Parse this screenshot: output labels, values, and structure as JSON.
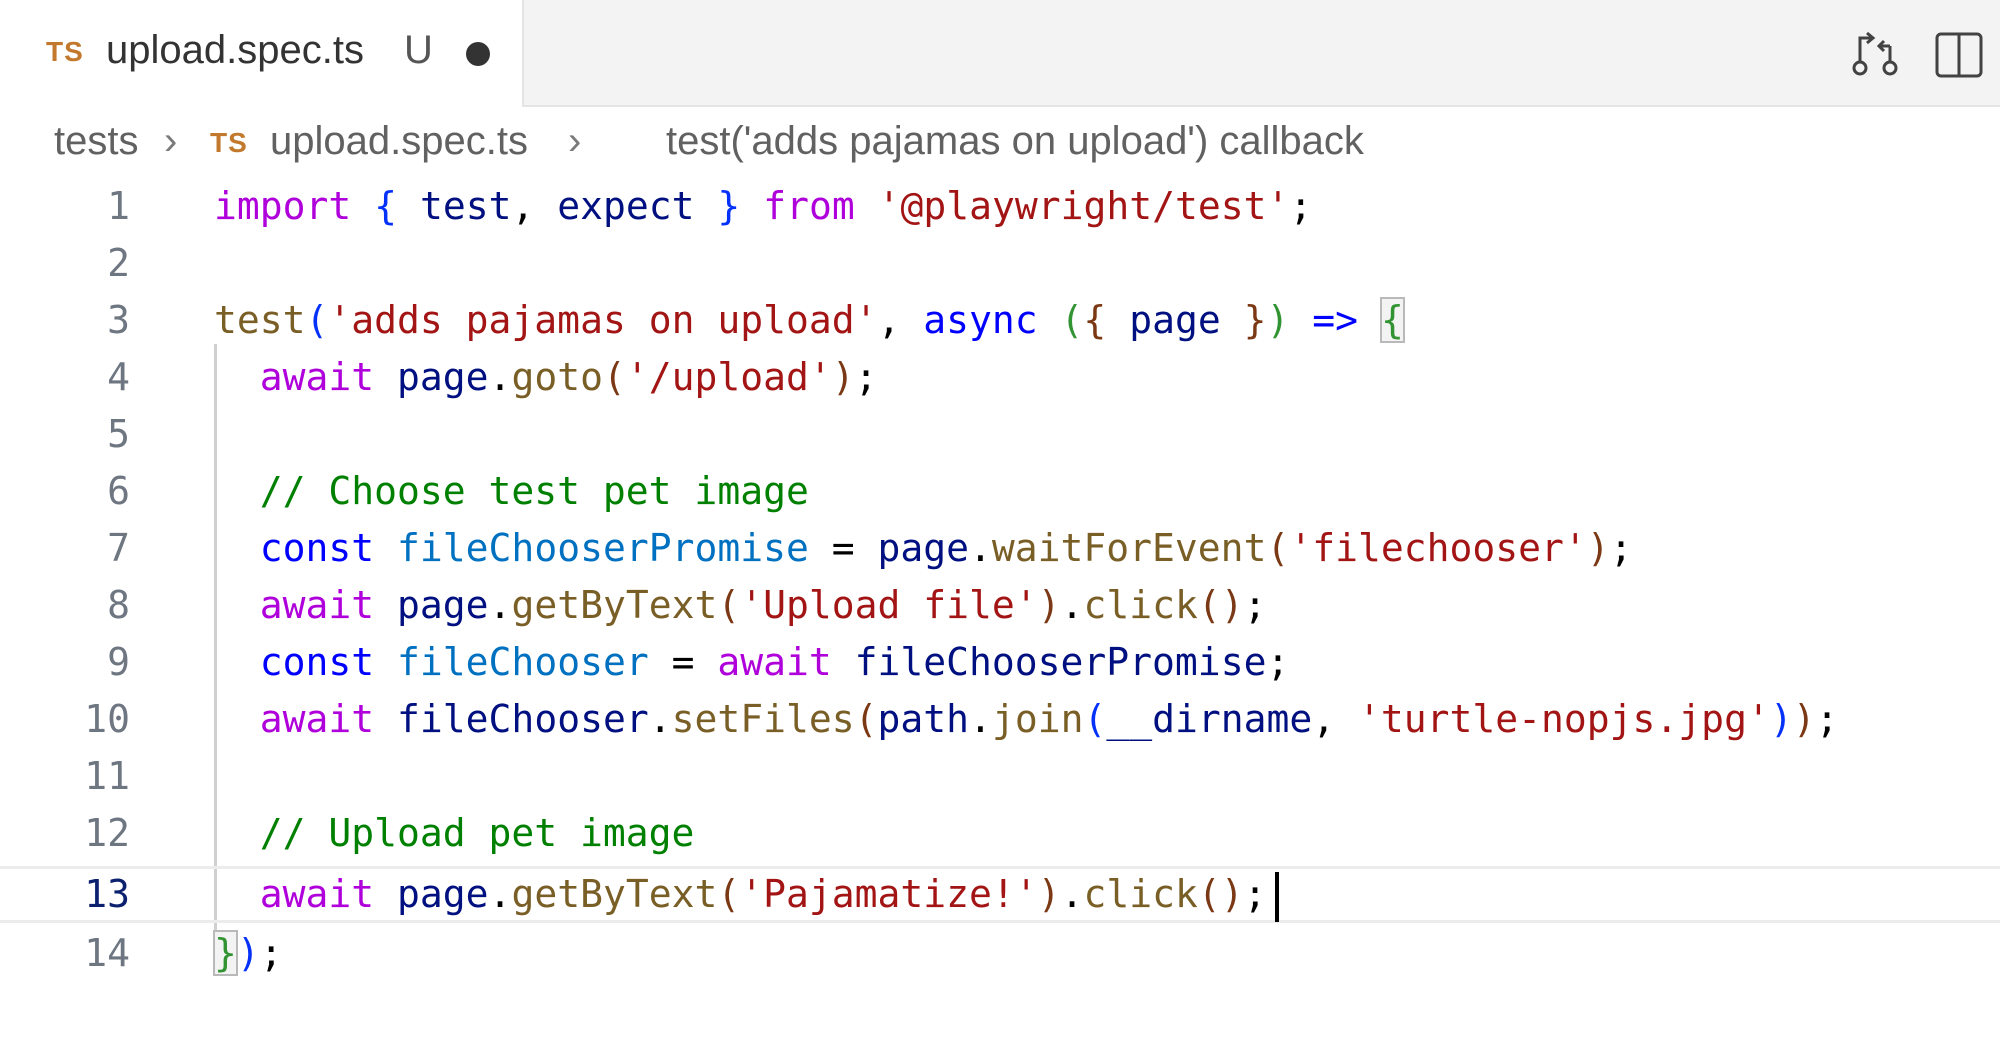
{
  "tab": {
    "file_type": "TS",
    "file_name": "upload.spec.ts",
    "git_status": "U"
  },
  "actions": [
    {
      "name": "open-changes-icon"
    },
    {
      "name": "split-editor-icon"
    }
  ],
  "breadcrumb": {
    "folder": "tests",
    "file_type": "TS",
    "file": "upload.spec.ts",
    "symbol": "test('adds pajamas on upload') callback"
  },
  "editor": {
    "current_line": 13,
    "lines": [
      {
        "n": "1",
        "text": "import { test, expect } from '@playwright/test';"
      },
      {
        "n": "2",
        "text": ""
      },
      {
        "n": "3",
        "text": "test('adds pajamas on upload', async ({ page }) => {"
      },
      {
        "n": "4",
        "text": "  await page.goto('/upload');"
      },
      {
        "n": "5",
        "text": ""
      },
      {
        "n": "6",
        "text": "  // Choose test pet image"
      },
      {
        "n": "7",
        "text": "  const fileChooserPromise = page.waitForEvent('filechooser');"
      },
      {
        "n": "8",
        "text": "  await page.getByText('Upload file').click();"
      },
      {
        "n": "9",
        "text": "  const fileChooser = await fileChooserPromise;"
      },
      {
        "n": "10",
        "text": "  await fileChooser.setFiles(path.join(__dirname, 'turtle-nopjs.jpg'));"
      },
      {
        "n": "11",
        "text": ""
      },
      {
        "n": "12",
        "text": "  // Upload pet image"
      },
      {
        "n": "13",
        "text": "  await page.getByText('Pajamatize!').click();"
      },
      {
        "n": "14",
        "text": "});"
      }
    ]
  }
}
